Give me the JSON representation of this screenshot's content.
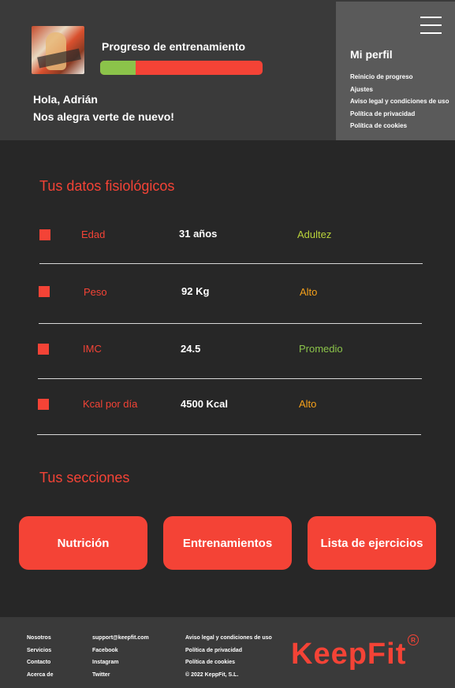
{
  "header": {
    "progress_label": "Progreso de entrenamiento",
    "progress_fraction": 0.22,
    "greeting_line1": "Hola, Adrián",
    "greeting_line2": "Nos alegra verte de nuevo!"
  },
  "profile": {
    "title": "Mi perfil",
    "links": [
      "Reinicio de progreso",
      "Ajustes",
      "Aviso legal y condiciones de uso",
      "Política de privacidad",
      "Política de cookies"
    ]
  },
  "physio": {
    "title": "Tus datos fisiológicos",
    "rows": [
      {
        "label": "Edad",
        "value": "31 años",
        "status": "Adultez",
        "status_color": "#b8d23a"
      },
      {
        "label": "Peso",
        "value": "92 Kg",
        "status": "Alto",
        "status_color": "#f5a01a"
      },
      {
        "label": "IMC",
        "value": "24.5",
        "status": "Promedio",
        "status_color": "#8bc34a"
      },
      {
        "label": "Kcal por día",
        "value": "4500 Kcal",
        "status": "Alto",
        "status_color": "#f5a01a"
      }
    ]
  },
  "sections": {
    "title": "Tus secciones",
    "buttons": [
      "Nutrición",
      "Entrenamientos",
      "Lista de ejercicios"
    ]
  },
  "footer": {
    "col1": [
      "Nosotros",
      "Servicios",
      "Contacto",
      "Acerca de"
    ],
    "col2": [
      "support@keepfit.com",
      "Facebook",
      "Instagram",
      "Twitter"
    ],
    "col3": [
      "Aviso legal y condiciones de uso",
      "Política de privacidad",
      "Política de cookies",
      "© 2022 KeppFit, S.L."
    ],
    "brand": "KeepFit",
    "registered": "R"
  },
  "colors": {
    "accent": "#f44336",
    "progress": "#8bc34a",
    "panel": "#3a3a3a",
    "background": "#272727"
  }
}
